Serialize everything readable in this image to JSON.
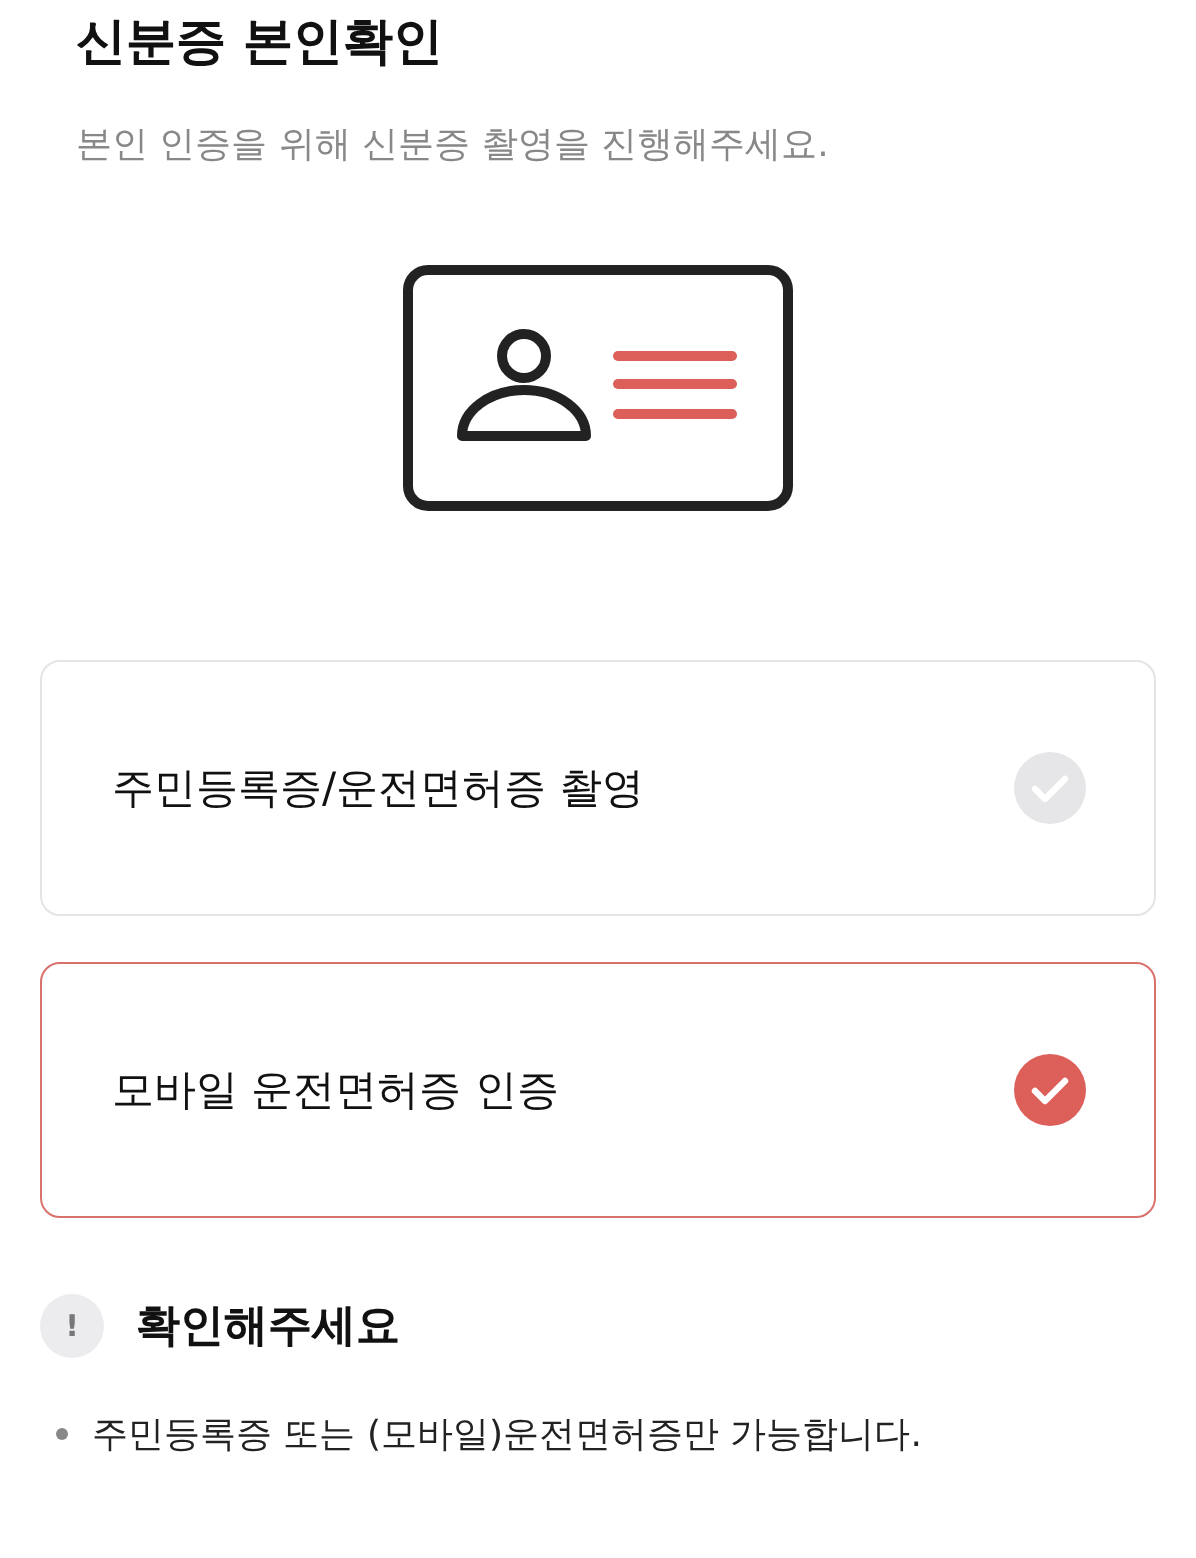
{
  "title": "신분증 본인확인",
  "subtitle": "본인 인증을 위해 신분증 촬영을 진행해주세요.",
  "options": [
    {
      "label": "주민등록증/운전면허증 촬영",
      "selected": false
    },
    {
      "label": "모바일 운전면허증 인증",
      "selected": true
    }
  ],
  "notice": {
    "icon": "!",
    "title": "확인해주세요",
    "items": [
      "주민등록증 또는 (모바일)운전면허증만 가능합니다."
    ]
  }
}
